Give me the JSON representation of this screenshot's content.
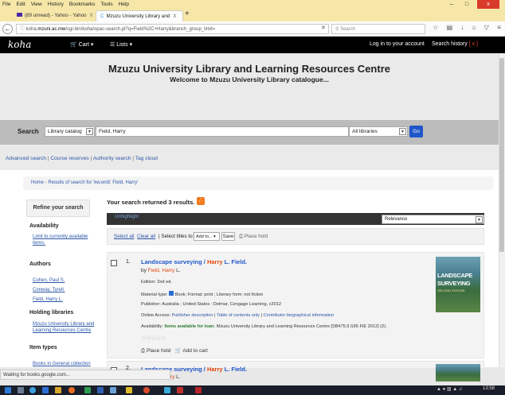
{
  "browser": {
    "menu": [
      "File",
      "Edit",
      "View",
      "History",
      "Bookmarks",
      "Tools",
      "Help"
    ],
    "window_buttons": [
      "–",
      "□",
      "x"
    ],
    "tabs": [
      {
        "label": "(89 unread) - Yahoo - Yahoo",
        "close": "X"
      },
      {
        "label": "Mzuzu University Library and",
        "close": "X"
      }
    ],
    "new_tab": "+",
    "url_host": "koha.mzuni.ac.mw",
    "url_path": "/cgi-bin/koha/opac-search.pl?q=Field%2C+Harry&branch_group_limit=",
    "url_prefix": "koha.",
    "url_host_bold": "mzuni.ac.mw",
    "search_placeholder": "Search",
    "status_text": "Waiting for books.google.com..."
  },
  "koha": {
    "logo": "koha",
    "cart": "Cart",
    "lists": "Lists",
    "login": "Log in to your account",
    "history": "Search history",
    "history_clear": "[ x ]"
  },
  "site": {
    "title": "Mzuzu University Library and Learning Resources Centre",
    "subtitle": "Welcome to Mzuzu University Library catalogue..."
  },
  "search": {
    "label": "Search",
    "catalog_option": "Library catalog",
    "query": "Field, Harry",
    "library_option": "All libraries",
    "go": "Go",
    "links": [
      "Advanced search",
      "Course reserves",
      "Authority search",
      "Tag cloud"
    ]
  },
  "breadcrumb": {
    "home": "Home",
    "current": "Results of search for 'kw,wrdl: Field, Harry'"
  },
  "sidebar": {
    "refine": "Refine your search",
    "availability_head": "Availability",
    "availability_link": "Limit to currently available items.",
    "authors_head": "Authors",
    "authors": [
      "Cohen, Paul S.",
      "Conway, Tyrell.",
      "Field, Harry L."
    ],
    "holding_head": "Holding libraries",
    "holding_link": "Mzuzu University Library and Learning Resources Centre",
    "itemtypes_head": "Item types",
    "itemtypes_link": "Books in General collection"
  },
  "results": {
    "count_text": "Your search returned 3 results.",
    "unhighlight": "Unhighlight",
    "relevance": "Relevance",
    "select_all": "Select all",
    "clear_all": "Clear all",
    "select_titles": "| Select titles to:",
    "add_to": "Add to...",
    "save": "Save",
    "place_hold": "Place hold",
    "items": [
      {
        "number": "1.",
        "title_a": "Landscape surveying / ",
        "title_hl": "Harry",
        "title_b": " L. Field.",
        "by": "by ",
        "author_hl": "Field, Harry",
        "author_b": " L.",
        "edition": "Edition: 2nd ed.",
        "material_label": "Material type:",
        "material_rest": "Book; Format: print ; Literary form: not fiction",
        "publisher": "Publisher: Australia ; United States : Delmar, Cengage Learning, c2012",
        "online_label": "Online Access: ",
        "online_link1": "Publisher description",
        "online_link2": "Table of contents only",
        "online_link3": "Contributor biographical information",
        "avail_label": "Availability: ",
        "avail_text": "Items available for loan:",
        "avail_rest": " Mzuzu University Library and Learning Resources Centre [SB475.9.S95 FIE 2012] (2).",
        "stars": "☆☆☆☆☆",
        "place_hold": "Place hold",
        "add_cart": "Add to cart",
        "cover_l1": "LANDSCAPE",
        "cover_l2": "SURVEYING",
        "cover_l3": "SECOND EDITION"
      },
      {
        "number": "2.",
        "title_a": "Landscape surveying / ",
        "title_hl": "Harry",
        "title_b": " L. Field.",
        "by": "by ",
        "author_hl": "Field, Harry",
        "author_b": " L."
      }
    ]
  },
  "taskbar": {
    "clock": "13:58"
  },
  "colors": {
    "menubar": "#f6e7a8",
    "koha_header": "#000000",
    "link": "#2b56a8",
    "highlight": "#e3460b",
    "go_button": "#1f56c9"
  }
}
